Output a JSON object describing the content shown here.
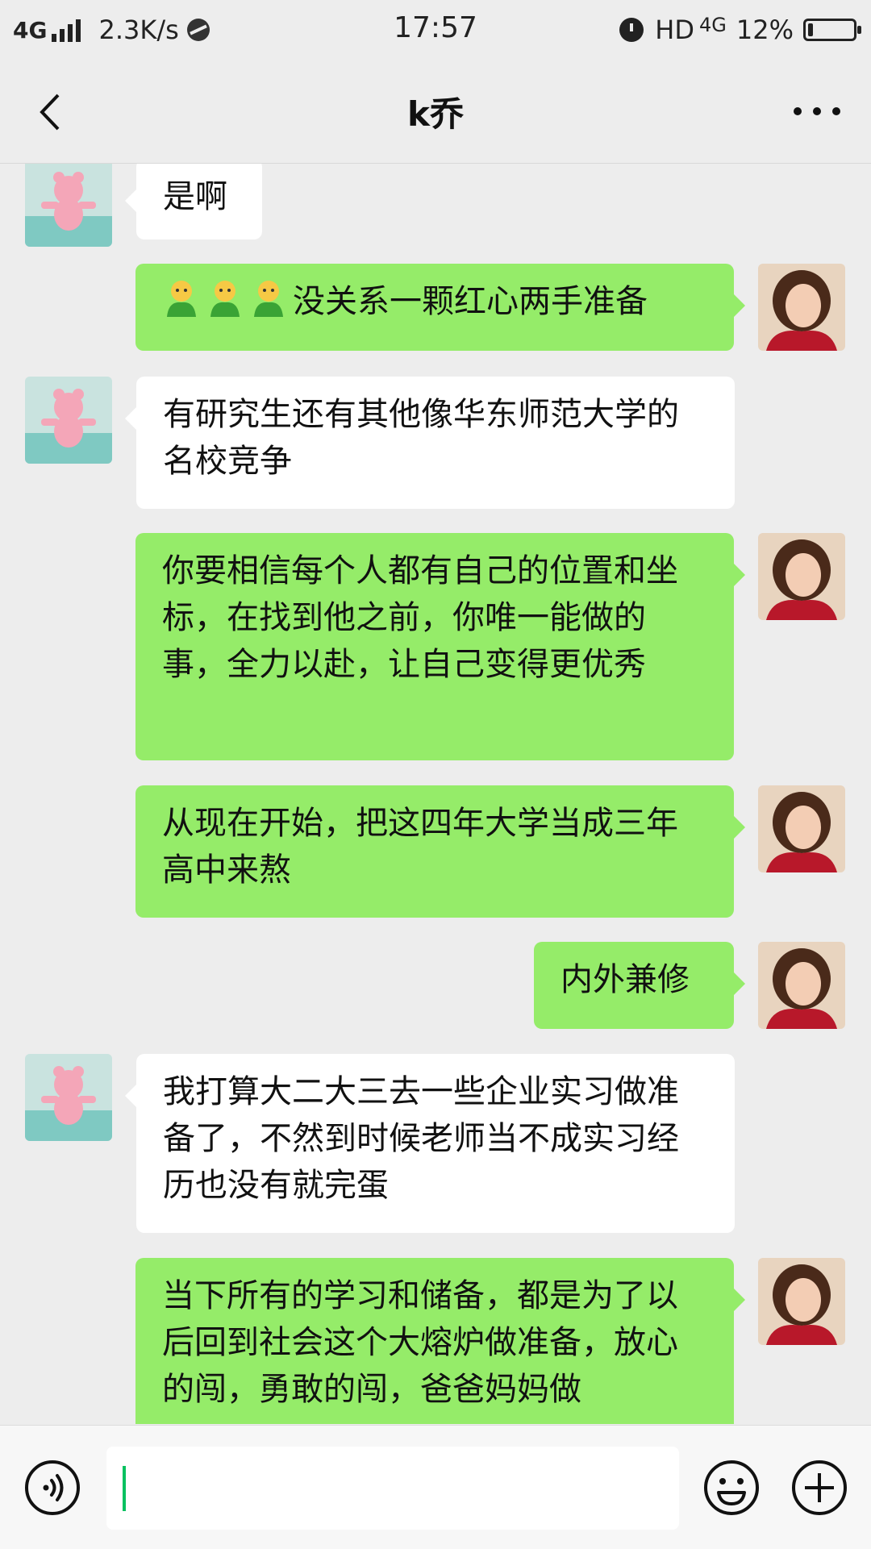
{
  "status_bar": {
    "network": "4G",
    "speed": "2.3K/s",
    "time": "17:57",
    "hd": "HD",
    "net_right": "4G",
    "battery": "12%"
  },
  "header": {
    "title": "k乔"
  },
  "messages": [
    {
      "side": "left",
      "text": "是啊"
    },
    {
      "side": "right",
      "emoji_count": 3,
      "emoji_name": "green-person-emoji",
      "text": "没关系一颗红心两手准备"
    },
    {
      "side": "left",
      "text": "有研究生还有其他像华东师范大学的名校竞争"
    },
    {
      "side": "right",
      "text": "你要相信每个人都有自己的位置和坐标，在找到他之前，你唯一能做的事，全力以赴，让自己变得更优秀"
    },
    {
      "side": "right",
      "text": "从现在开始，把这四年大学当成三年高中来熬"
    },
    {
      "side": "right",
      "text": "内外兼修"
    },
    {
      "side": "left",
      "text": "我打算大二大三去一些企业实习做准备了，不然到时候老师当不成实习经历也没有就完蛋"
    },
    {
      "side": "right",
      "text": "当下所有的学习和储备，都是为了以后回到社会这个大熔炉做准备，放心的闯，勇敢的闯，爸爸妈妈做"
    }
  ],
  "input": {
    "value": ""
  },
  "colors": {
    "self_bubble": "#95ec69",
    "other_bubble": "#ffffff",
    "background": "#ededed",
    "cursor": "#07c160"
  }
}
